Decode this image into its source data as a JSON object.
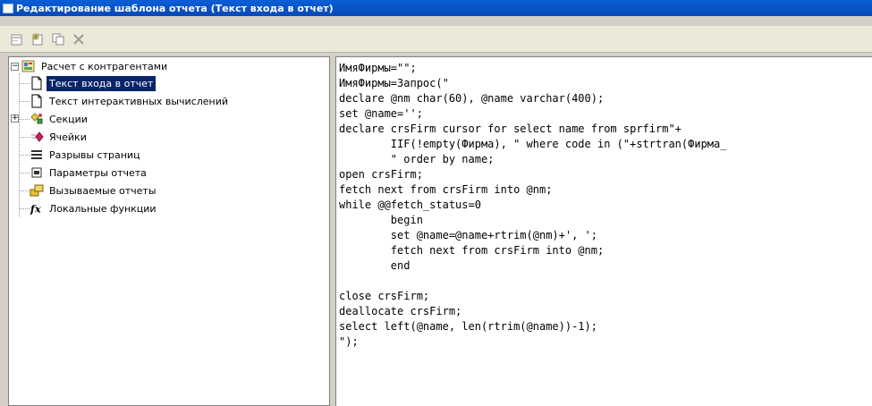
{
  "window": {
    "title": "Редактирование шаблона отчета (Текст входа в отчет)"
  },
  "toolbar": {
    "buttons": [
      "properties-icon",
      "add-icon",
      "copy-icon",
      "delete-icon"
    ]
  },
  "tree": {
    "root": {
      "label": "Расчет с контрагентами",
      "icon": "report-icon"
    },
    "items": [
      {
        "label": "Текст входа в отчет",
        "icon": "document-icon",
        "selected": true
      },
      {
        "label": "Текст интерактивных вычислений",
        "icon": "document-icon"
      },
      {
        "label": "Секции",
        "icon": "sections-icon",
        "expandable": true
      },
      {
        "label": "Ячейки",
        "icon": "cells-icon"
      },
      {
        "label": "Разрывы страниц",
        "icon": "page-breaks-icon"
      },
      {
        "label": "Параметры отчета",
        "icon": "parameters-icon"
      },
      {
        "label": "Вызываемые отчеты",
        "icon": "called-reports-icon"
      },
      {
        "label": "Локальные функции",
        "icon": "function-icon"
      }
    ]
  },
  "editor": {
    "lines": [
      "ИмяФирмы=\"\";",
      "ИмяФирмы=Запрос(\"",
      "declare @nm char(60), @name varchar(400);",
      "set @name='';",
      "declare crsFirm cursor for select name from sprfirm\"+",
      "        IIF(!empty(Фирма), \" where code in (\"+strtran(Фирма_",
      "        \" order by name;",
      "open crsFirm;",
      "fetch next from crsFirm into @nm;",
      "while @@fetch_status=0",
      "        begin",
      "        set @name=@name+rtrim(@nm)+', ';",
      "        fetch next from crsFirm into @nm;",
      "        end",
      "",
      "close crsFirm;",
      "deallocate crsFirm;",
      "select left(@name, len(rtrim(@name))-1);",
      "\");"
    ]
  }
}
